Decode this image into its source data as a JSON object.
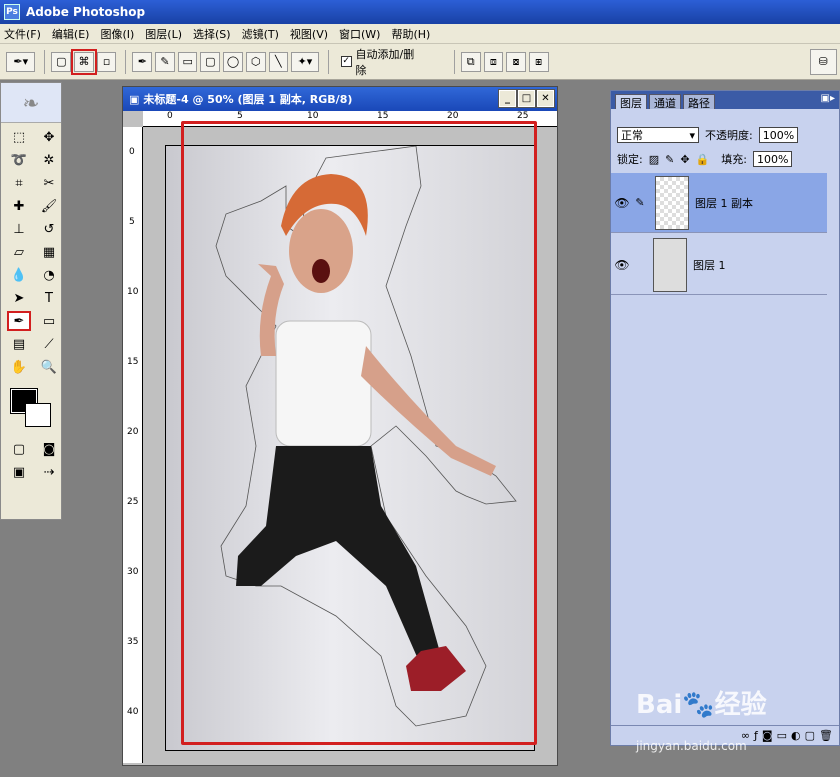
{
  "app": {
    "title": "Adobe Photoshop",
    "icon": "ps-icon"
  },
  "menu": [
    "文件(F)",
    "编辑(E)",
    "图像(I)",
    "图层(L)",
    "选择(S)",
    "滤镜(T)",
    "视图(V)",
    "窗口(W)",
    "帮助(H)"
  ],
  "options": {
    "autoadd_label": "自动添加/删除",
    "autoadd_checked": "✓"
  },
  "document": {
    "title": "未标题-4 @ 50% (图层 1 副本, RGB/8)",
    "ruler_top": [
      "0",
      "5",
      "10",
      "15",
      "20",
      "25"
    ],
    "ruler_left": [
      "0",
      "5",
      "10",
      "15",
      "20",
      "25",
      "30",
      "35",
      "40"
    ]
  },
  "layers_panel": {
    "tabs": [
      "图层",
      "通道",
      "路径"
    ],
    "blend_mode": "正常",
    "opacity_label": "不透明度:",
    "opacity_value": "100%",
    "lock_label": "锁定:",
    "fill_label": "填充:",
    "fill_value": "100%",
    "layers": [
      {
        "name": "图层 1 副本",
        "selected": true
      },
      {
        "name": "图层 1",
        "selected": false
      }
    ]
  },
  "watermark": {
    "brand": "Bai",
    "brand2": "经验",
    "url": "jingyan.baidu.com"
  },
  "colors": {
    "accent": "#d21f1f",
    "titlebar": "#1941a5",
    "panel": "#c8d2ee",
    "selected_layer": "#8aa6e6"
  }
}
